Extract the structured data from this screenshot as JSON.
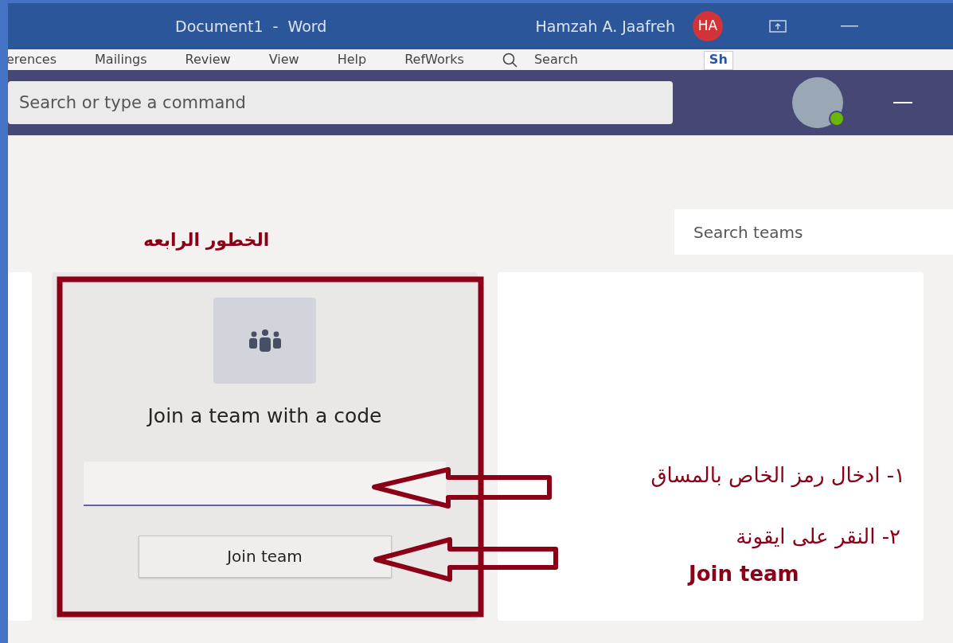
{
  "word_titlebar": {
    "title": "Document1  -  Word",
    "user_name": "Hamzah A. Jaafreh",
    "user_initials": "HA"
  },
  "ribbon": {
    "tabs": [
      "erences",
      "Mailings",
      "Review",
      "View",
      "Help",
      "RefWorks"
    ],
    "search": "Search",
    "share": "Sh"
  },
  "teams_header": {
    "search_placeholder": "Search or type a command"
  },
  "search_teams": {
    "placeholder": "Search teams"
  },
  "join_card": {
    "title": "Join a team with a code",
    "button": "Join team"
  },
  "annotations": {
    "heading": "الخطور الرابعه",
    "steps": [
      "١- ادخال رمز الخاص بالمساق",
      "٢- النقر على ايقونة"
    ],
    "step_2_label": "Join team"
  }
}
